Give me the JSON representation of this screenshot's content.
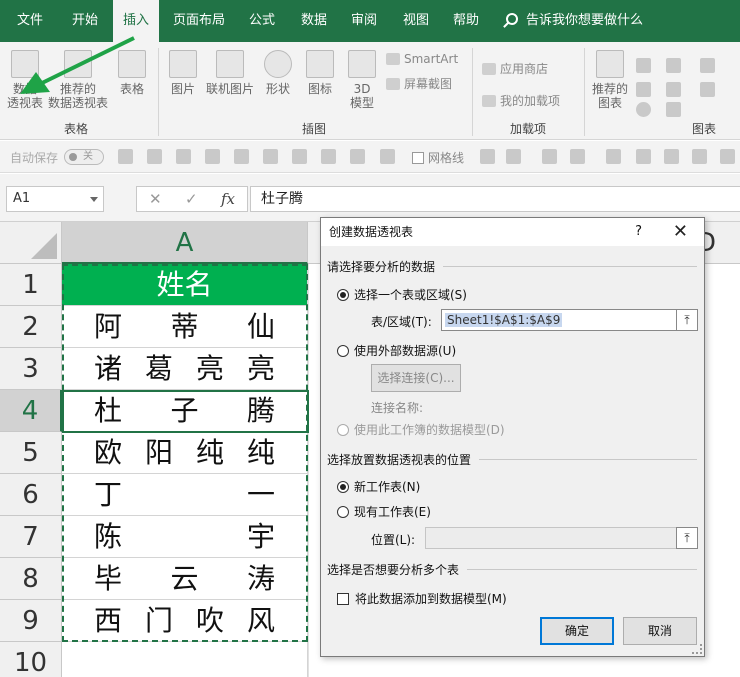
{
  "tabs": [
    "文件",
    "开始",
    "插入",
    "页面布局",
    "公式",
    "数据",
    "审阅",
    "视图",
    "帮助"
  ],
  "tell_me": "告诉我你想要做什么",
  "ribbon": {
    "pivot_label1": "数据",
    "pivot_label2": "透视表",
    "rec_pivot_label1": "推荐的",
    "rec_pivot_label2": "数据透视表",
    "table_label": "表格",
    "picture_label": "图片",
    "online_picture_label": "联机图片",
    "shapes_label": "形状",
    "icons_label": "图标",
    "model3d_label1": "3D",
    "model3d_label2": "模型",
    "smartart_label": "SmartArt",
    "screenshot_label": "屏幕截图",
    "store_label": "应用商店",
    "myaddins_label": "我的加载项",
    "rec_charts_label1": "推荐的",
    "rec_charts_label2": "图表",
    "group_tables": "表格",
    "group_illustrations": "插图",
    "group_addins": "加载项",
    "group_charts": "图表"
  },
  "qat": {
    "autosave": "自动保存",
    "toggle": "关",
    "gridlines": "网格线"
  },
  "formula_bar": {
    "name_box": "A1",
    "cancel": "✕",
    "enter": "✓",
    "fx": "fx",
    "value": "杜子腾"
  },
  "sheet": {
    "col_a": "A",
    "col_d": "D",
    "rows": [
      "1",
      "2",
      "3",
      "4",
      "5",
      "6",
      "7",
      "8",
      "9",
      "10"
    ],
    "header": "姓名",
    "names": [
      [
        "阿",
        "蒂",
        "仙"
      ],
      [
        "诸",
        "葛",
        "亮",
        "亮"
      ],
      [
        "杜",
        "子",
        "腾"
      ],
      [
        "欧",
        "阳",
        "纯",
        "纯"
      ],
      [
        "丁",
        "一"
      ],
      [
        "陈",
        "宇"
      ],
      [
        "毕",
        "云",
        "涛"
      ],
      [
        "西",
        "门",
        "吹",
        "风"
      ]
    ],
    "header_color": "#00b050"
  },
  "dialog": {
    "title": "创建数据透视表",
    "help": "?",
    "close": "✕",
    "section1": "请选择要分析的数据",
    "opt_range": "选择一个表或区域(S)",
    "range_label": "表/区域(T):",
    "range_value": "Sheet1!$A$1:$A$9",
    "opt_external": "使用外部数据源(U)",
    "choose_conn": "选择连接(C)...",
    "conn_name": "连接名称:",
    "opt_model": "使用此工作簿的数据模型(D)",
    "section2": "选择放置数据透视表的位置",
    "opt_new": "新工作表(N)",
    "opt_existing": "现有工作表(E)",
    "location_label": "位置(L):",
    "location_value": "",
    "section3": "选择是否想要分析多个表",
    "add_model": "将此数据添加到数据模型(M)",
    "ok": "确定",
    "cancel": "取消"
  },
  "colors": {
    "brand": "#217346",
    "header_fill": "#00b050",
    "arrow": "#1fa347"
  }
}
